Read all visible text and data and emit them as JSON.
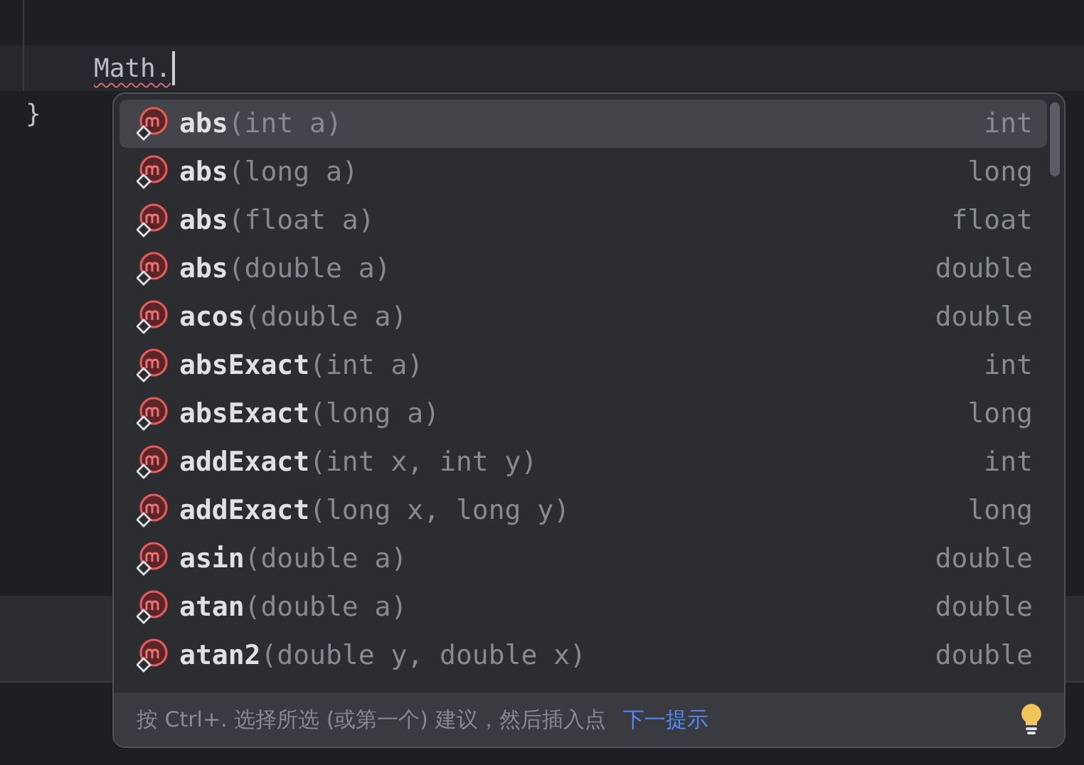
{
  "editor": {
    "lines": [
      {
        "kind": "current",
        "code": "Math.",
        "error": true
      },
      {
        "kind": "plain",
        "code": "}",
        "error": false
      }
    ]
  },
  "completion": {
    "items": [
      {
        "name": "abs",
        "params": "(int a)",
        "type": "int",
        "selected": true
      },
      {
        "name": "abs",
        "params": "(long a)",
        "type": "long",
        "selected": false
      },
      {
        "name": "abs",
        "params": "(float a)",
        "type": "float",
        "selected": false
      },
      {
        "name": "abs",
        "params": "(double a)",
        "type": "double",
        "selected": false
      },
      {
        "name": "acos",
        "params": "(double a)",
        "type": "double",
        "selected": false
      },
      {
        "name": "absExact",
        "params": "(int a)",
        "type": "int",
        "selected": false
      },
      {
        "name": "absExact",
        "params": "(long a)",
        "type": "long",
        "selected": false
      },
      {
        "name": "addExact",
        "params": "(int x, int y)",
        "type": "int",
        "selected": false
      },
      {
        "name": "addExact",
        "params": "(long x, long y)",
        "type": "long",
        "selected": false
      },
      {
        "name": "asin",
        "params": "(double a)",
        "type": "double",
        "selected": false
      },
      {
        "name": "atan",
        "params": "(double a)",
        "type": "double",
        "selected": false
      },
      {
        "name": "atan2",
        "params": "(double y, double x)",
        "type": "double",
        "selected": false
      }
    ],
    "hint": "按 Ctrl+. 选择所选 (或第一个) 建议，然后插入点",
    "next_tip": "下一提示"
  }
}
